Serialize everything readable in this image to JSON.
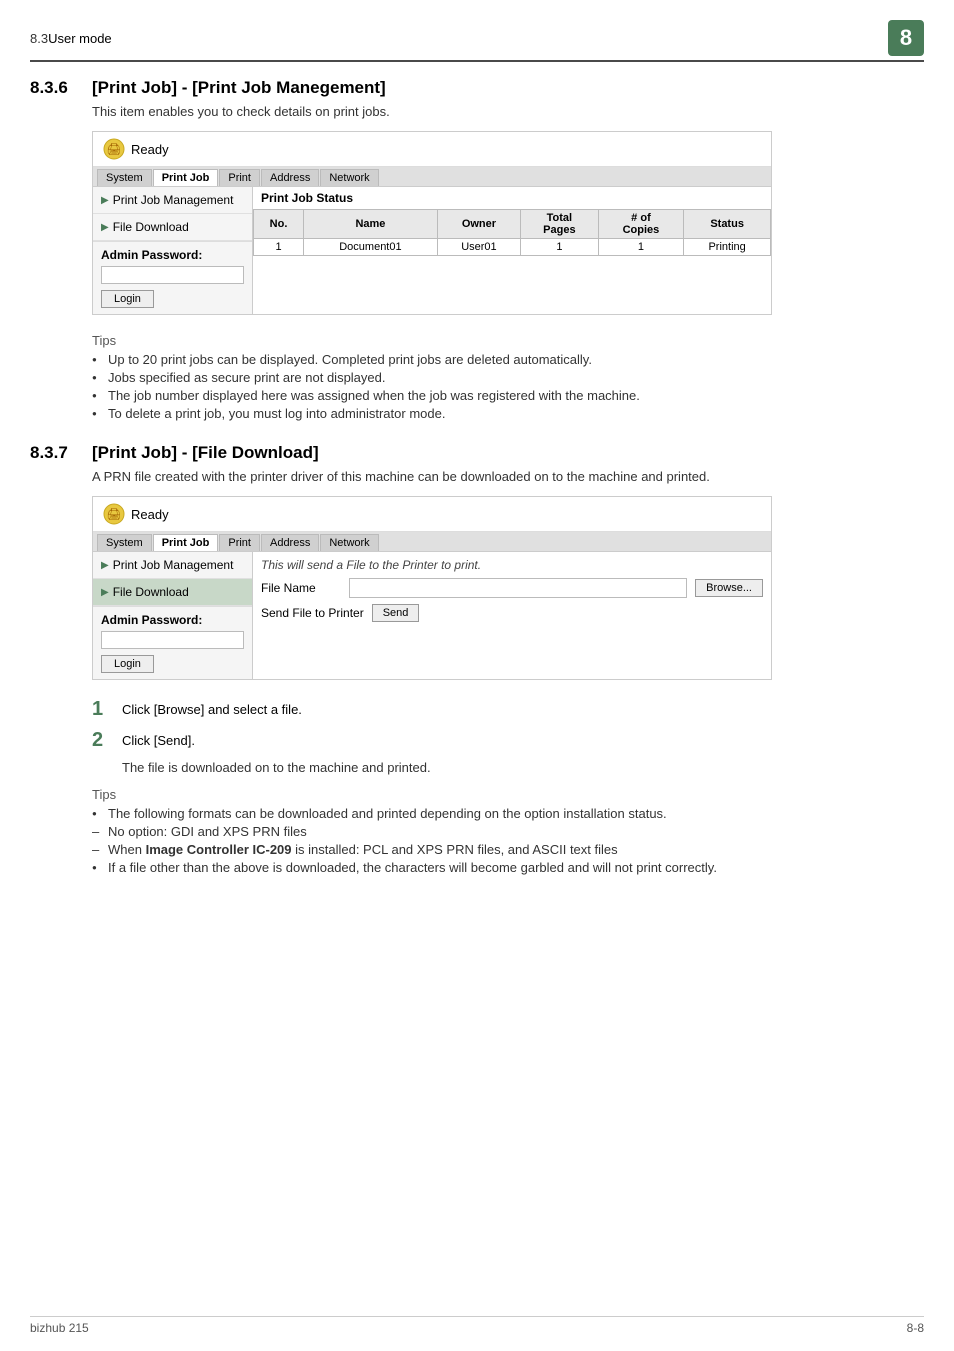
{
  "header": {
    "section": "8.3",
    "section_label": "User mode",
    "chapter": "8"
  },
  "section1": {
    "num": "8.3.6",
    "title": "[Print Job] - [Print Job Manegement]",
    "description": "This item enables you to check details on print jobs."
  },
  "section2": {
    "num": "8.3.7",
    "title": "[Print Job] - [File Download]",
    "description": "A PRN file created with the printer driver of this machine can be downloaded on to the machine and printed."
  },
  "printer_ui": {
    "status": "Ready",
    "nav_tabs": [
      "System",
      "Print Job",
      "Print",
      "Address",
      "Network"
    ],
    "active_tab": "Print Job"
  },
  "sidebar1": {
    "items": [
      {
        "label": "Print Job Management",
        "active": false
      },
      {
        "label": "File Download",
        "active": false
      }
    ]
  },
  "sidebar2": {
    "items": [
      {
        "label": "Print Job Management",
        "active": false
      },
      {
        "label": "File Download",
        "active": true
      }
    ]
  },
  "print_job_status": {
    "label": "Print Job Status",
    "columns": [
      "No.",
      "Name",
      "Owner",
      "Total Pages",
      "# of Copies",
      "Status"
    ],
    "rows": [
      {
        "no": "1",
        "name": "Document01",
        "owner": "User01",
        "total_pages": "1",
        "copies": "1",
        "status": "Printing"
      }
    ]
  },
  "admin": {
    "label": "Admin Password:",
    "login_button": "Login"
  },
  "tips1": {
    "title": "Tips",
    "items": [
      "Up to 20 print jobs can be displayed. Completed print jobs are deleted automatically.",
      "Jobs specified as secure print are not displayed.",
      "The job number displayed here was assigned when the job was registered with the machine.",
      "To delete a print job, you must log into administrator mode."
    ]
  },
  "file_download_ui": {
    "note": "This will send a File to the Printer to print.",
    "file_name_label": "File Name",
    "browse_button": "Browse...",
    "send_file_label": "Send File to Printer",
    "send_button": "Send"
  },
  "steps": [
    {
      "num": "1",
      "text": "Click [Browse] and select a file."
    },
    {
      "num": "2",
      "text": "Click [Send].",
      "sub": "The file is downloaded on to the machine and printed."
    }
  ],
  "tips2": {
    "title": "Tips",
    "items": [
      {
        "type": "bullet",
        "text": "The following formats can be downloaded and printed depending on the option installation status."
      },
      {
        "type": "dash",
        "text": "No option: GDI and XPS PRN files"
      },
      {
        "type": "dash",
        "text": "When Image Controller IC-209 is installed: PCL and XPS PRN files, and ASCII text files",
        "bold_part": "Image Controller IC-209"
      },
      {
        "type": "bullet",
        "text": "If a file other than the above is downloaded, the characters will become garbled and will not print correctly."
      }
    ]
  },
  "footer": {
    "left": "bizhub 215",
    "right": "8-8"
  }
}
